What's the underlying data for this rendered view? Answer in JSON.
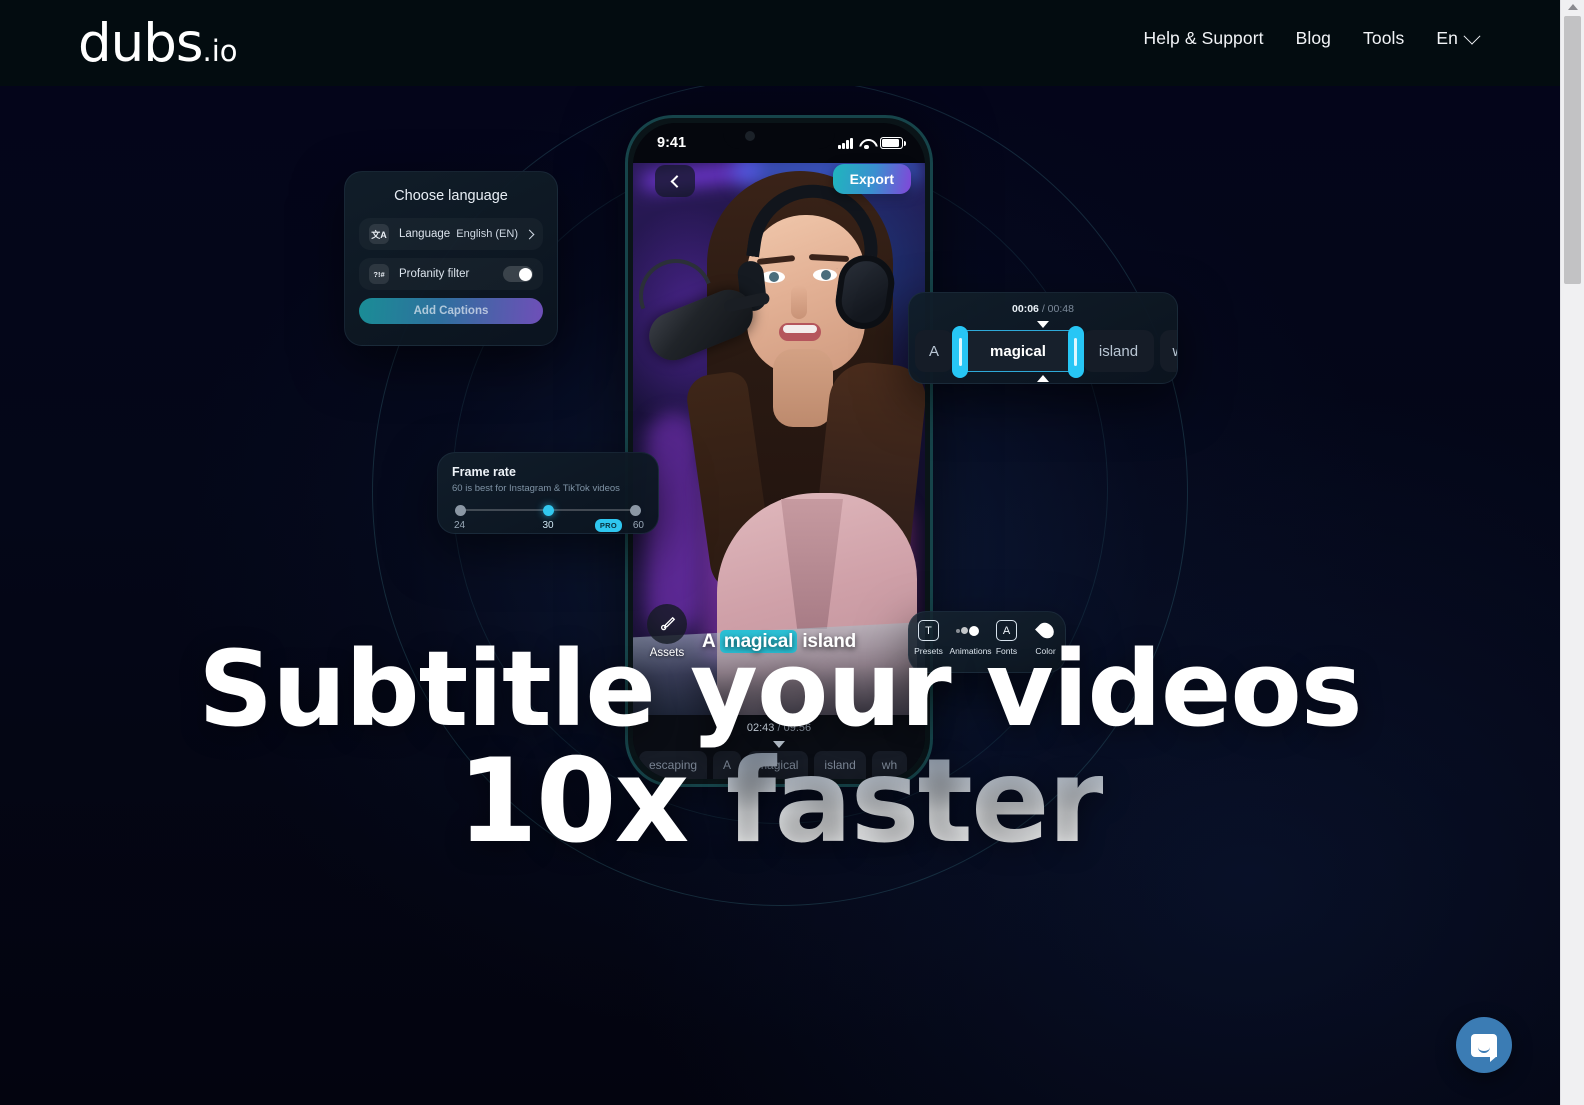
{
  "header": {
    "logo_main": "dubs",
    "logo_suffix": ".io",
    "nav": [
      {
        "label": "Help & Support"
      },
      {
        "label": "Blog"
      },
      {
        "label": "Tools"
      }
    ],
    "language_selector": {
      "label": "En",
      "icon": "chevron-down-icon"
    }
  },
  "hero": {
    "headline_line1": "Subtitle your videos",
    "headline_line2_plain": "10x ",
    "headline_line2_accent": "faster"
  },
  "phone": {
    "status_bar": {
      "time": "9:41",
      "signal_icon": "cellular-bars-icon",
      "wifi_icon": "wifi-icon",
      "battery_icon": "battery-icon"
    },
    "back_button": {
      "icon": "chevron-left-icon"
    },
    "export_button": {
      "label": "Export"
    },
    "caption": {
      "before": "A ",
      "highlight": "magical",
      "after": " island"
    },
    "assets_button": {
      "label": "Assets",
      "icon": "brush-icon"
    },
    "timeline": {
      "current_time": "02:43",
      "separator": " / ",
      "total_time": "09:56",
      "words": [
        "escaping",
        "A",
        "magical",
        "island",
        "wh"
      ]
    }
  },
  "cards": {
    "language": {
      "title": "Choose language",
      "rows": [
        {
          "icon": "translate-icon",
          "icon_glyph": "文A",
          "label": "Language",
          "value": "English (EN)",
          "chevron": "chevron-right-icon"
        },
        {
          "icon": "profanity-icon",
          "icon_glyph": "?!#",
          "label": "Profanity filter",
          "toggle_state": "on"
        }
      ],
      "cta": "Add Captions"
    },
    "frame_rate": {
      "title": "Frame rate",
      "subtitle": "60 is best for Instagram & TikTok videos",
      "ticks": [
        "24",
        "30",
        "60"
      ],
      "selected": "30",
      "pro_badge": "PRO"
    },
    "word_timeline": {
      "current_time": "00:06",
      "separator": " / ",
      "total_time": "00:48",
      "words": [
        "A",
        "magical",
        "island",
        "wh"
      ],
      "selected_word": "magical"
    },
    "tools": [
      {
        "label": "Presets",
        "icon": "text-preset-icon",
        "glyph": "T"
      },
      {
        "label": "Animations",
        "icon": "animations-icon"
      },
      {
        "label": "Fonts",
        "icon": "fonts-icon",
        "glyph": "A"
      },
      {
        "label": "Color",
        "icon": "color-drop-icon"
      }
    ]
  },
  "chat": {
    "icon": "chat-bubble-icon"
  },
  "colors": {
    "accent_cyan": "#2fc6ef",
    "accent_purple": "#8246d8",
    "background": "#03040d",
    "header_bg": "#030c10",
    "chat_blue": "#3b7cb4"
  }
}
